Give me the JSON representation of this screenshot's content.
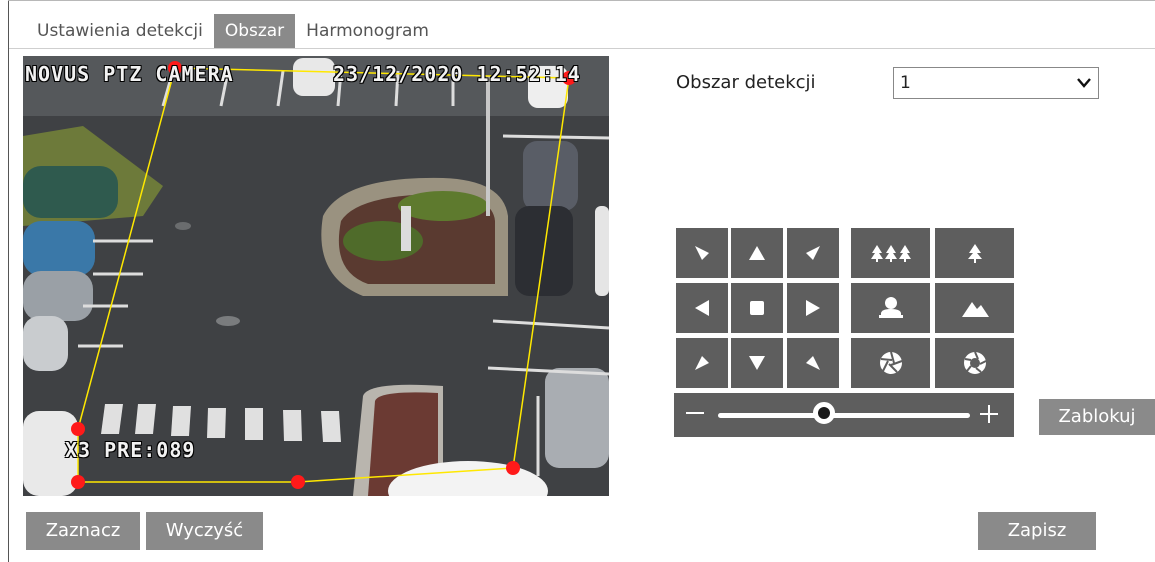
{
  "tabs": [
    {
      "label": "Ustawienia detekcji",
      "active": false
    },
    {
      "label": "Obszar",
      "active": true
    },
    {
      "label": "Harmonogram",
      "active": false
    }
  ],
  "camera": {
    "osd_title": "NOVUS PTZ CAMERA",
    "osd_datetime": "23/12/2020 12:52:14",
    "osd_status": "X3 PRE:089",
    "zone_color": "#ffe800",
    "zone_point_color": "#ff1a1a"
  },
  "form": {
    "area_label": "Obszar detekcji",
    "area_value": "1"
  },
  "ptz": {
    "buttons": [
      "up-left",
      "up",
      "up-right",
      "left",
      "center",
      "right",
      "down-left",
      "down",
      "down-right"
    ],
    "lens_buttons": [
      "focus-far",
      "focus-near",
      "zoom-in",
      "zoom-out",
      "iris-close",
      "iris-open"
    ],
    "zoom_level": 0.42,
    "lock_label": "Zablokuj"
  },
  "actions": {
    "mark_label": "Zaznacz",
    "clear_label": "Wyczyść",
    "save_label": "Zapisz"
  },
  "colors": {
    "button_gray": "#8a8a8a",
    "pad_gray": "#5e5e5e"
  }
}
